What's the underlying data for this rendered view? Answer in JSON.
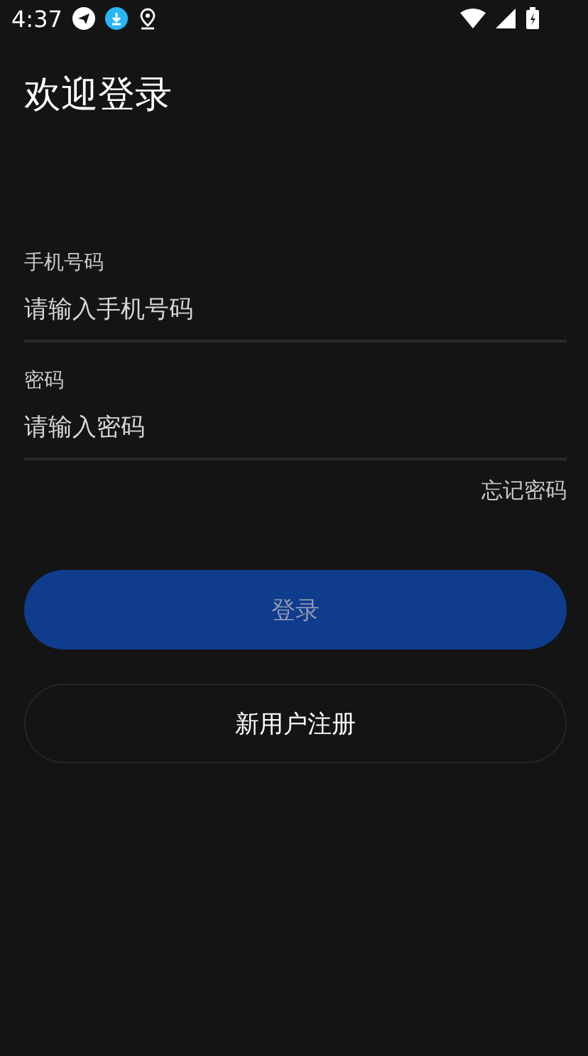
{
  "status_bar": {
    "time": "4:37"
  },
  "title": "欢迎登录",
  "fields": [
    {
      "label": "手机号码",
      "placeholder": "请输入手机号码"
    },
    {
      "label": "密码",
      "placeholder": "请输入密码"
    }
  ],
  "forgot_link": "忘记密码",
  "login_button": {
    "label": "登录",
    "disabled": true
  },
  "register_button": "新用户注册"
}
